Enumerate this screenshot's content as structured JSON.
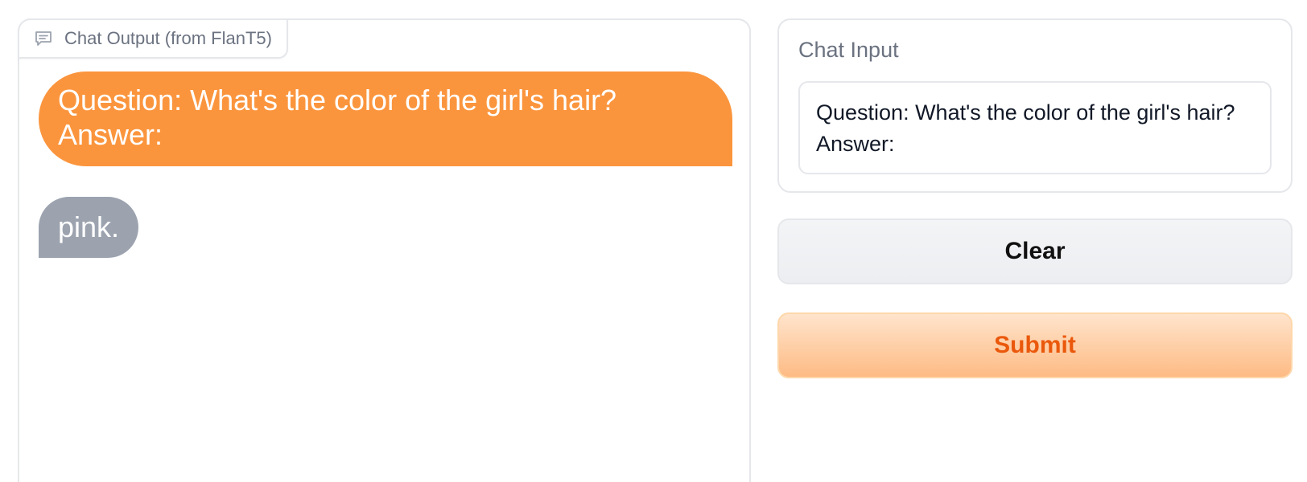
{
  "chat_output": {
    "label": "Chat Output (from FlanT5)",
    "label_icon": "chat-bubble-icon",
    "messages": [
      {
        "role": "user",
        "text": "Question: What's the color of the girl's hair?\nAnswer:"
      },
      {
        "role": "bot",
        "text": "pink."
      }
    ]
  },
  "chat_input": {
    "label": "Chat Input",
    "value": "Question: What's the color of the girl's hair?\nAnswer:"
  },
  "buttons": {
    "clear_label": "Clear",
    "submit_label": "Submit"
  },
  "colors": {
    "user_bubble": "#fb953d",
    "bot_bubble": "#9ca3af",
    "submit_text": "#ea580c",
    "submit_bg": "#fdbb84"
  }
}
